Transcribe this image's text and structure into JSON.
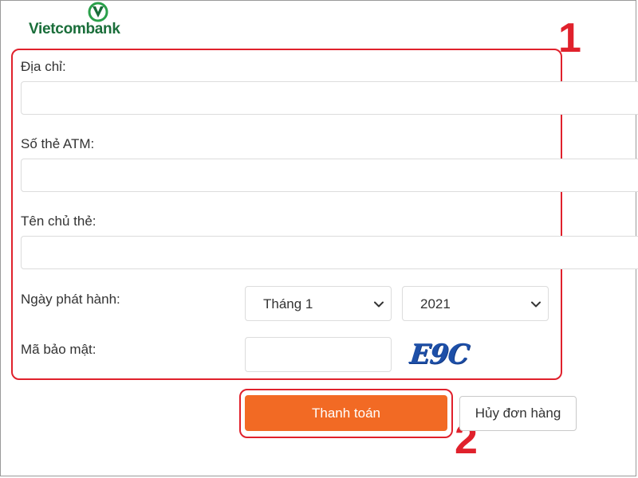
{
  "brand": {
    "name": "Vietcombank",
    "logo_icon": "vietcombank-logo-icon",
    "color": "#1a6e3a"
  },
  "form": {
    "address_label": "Địa chỉ:",
    "address_value": "",
    "card_number_label": "Số thẻ ATM:",
    "card_number_value": "",
    "card_holder_label": "Tên chủ thẻ:",
    "card_holder_value": "",
    "issue_date_label": "Ngày phát hành:",
    "issue_month": "Tháng 1",
    "issue_year": "2021",
    "security_code_label": "Mã bảo mật:",
    "security_code_value": "",
    "captcha_text": "E9C"
  },
  "actions": {
    "pay_label": "Thanh toán",
    "cancel_label": "Hủy đơn hàng"
  },
  "annotations": {
    "step1": "1",
    "step2": "2",
    "color": "#e0212c"
  },
  "colors": {
    "pay_button": "#f26a24",
    "captcha": "#1d4fa8"
  }
}
